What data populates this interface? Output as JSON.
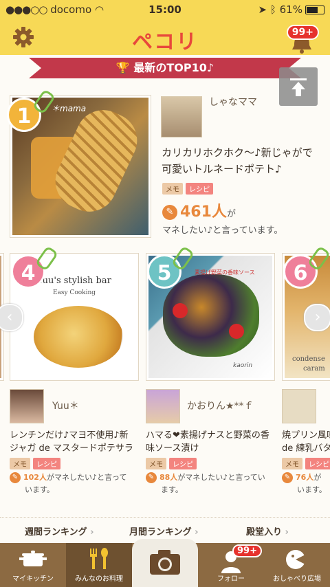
{
  "status": {
    "carrier": "docomo",
    "time": "15:00",
    "battery": "61%"
  },
  "app": {
    "logo": "ペコリ",
    "notification_count": "99+"
  },
  "banner": {
    "title": "最新のTOP10♪"
  },
  "top": {
    "rank": "1",
    "photo_caption": "＊mama",
    "user": "しゃなママ",
    "title_line1": "カリカリホクホク〜♪新じゃがで",
    "title_line2": "可愛いトルネードポテト♪",
    "tag_memo": "メモ",
    "tag_recipe": "レシピ",
    "count": "461人",
    "count_suffix": "が",
    "note": "マネしたい♪と言っています。"
  },
  "cards": [
    {
      "rank": "4",
      "photo_line1": "Yuu's stylish bar",
      "photo_line2": "Easy Cooking",
      "user": "Yuu＊",
      "title_line1": "レンチンだけ♪マヨ不使用♪新",
      "title_line2": "ジャガ de マスタードポテサラ",
      "tag_memo": "メモ",
      "tag_recipe": "レシピ",
      "count": "102人",
      "stat_line1": "がマネしたい♪と言って",
      "stat_line2": "います。"
    },
    {
      "rank": "5",
      "photo_line1": "素揚げ野菜の香味ソース",
      "photo_line2": "kaorin",
      "user": "かおりん★**ｆ",
      "title_line1": "ハマる❤素揚げナスと野菜の香",
      "title_line2": "味ソース漬け",
      "tag_memo": "メモ",
      "tag_recipe": "レシピ",
      "count": "88人",
      "stat_line1": "がマネしたい♪と言ってい",
      "stat_line2": "ます。"
    },
    {
      "rank": "6",
      "photo_line1": "condense",
      "photo_line2": "caram",
      "user": "",
      "title_line1": "焼プリン風味",
      "title_line2": "de 練乳バタ",
      "tag_memo": "メモ",
      "tag_recipe": "レシピ",
      "count": "76人",
      "stat_line1": "が",
      "stat_line2": "います。"
    }
  ],
  "rankings": {
    "weekly": "週間ランキング",
    "monthly": "月間ランキング",
    "hall": "殿堂入り"
  },
  "tabs": {
    "my_kitchen": "マイキッチン",
    "everyone": "みんなのお料理",
    "follow": "フォロー",
    "chat": "おしゃべり広場",
    "follow_badge": "99+"
  },
  "colors": {
    "header": "#f7d956",
    "ribbon": "#c2384a",
    "accent": "#e8483b",
    "tabbar": "#8c6a42"
  }
}
